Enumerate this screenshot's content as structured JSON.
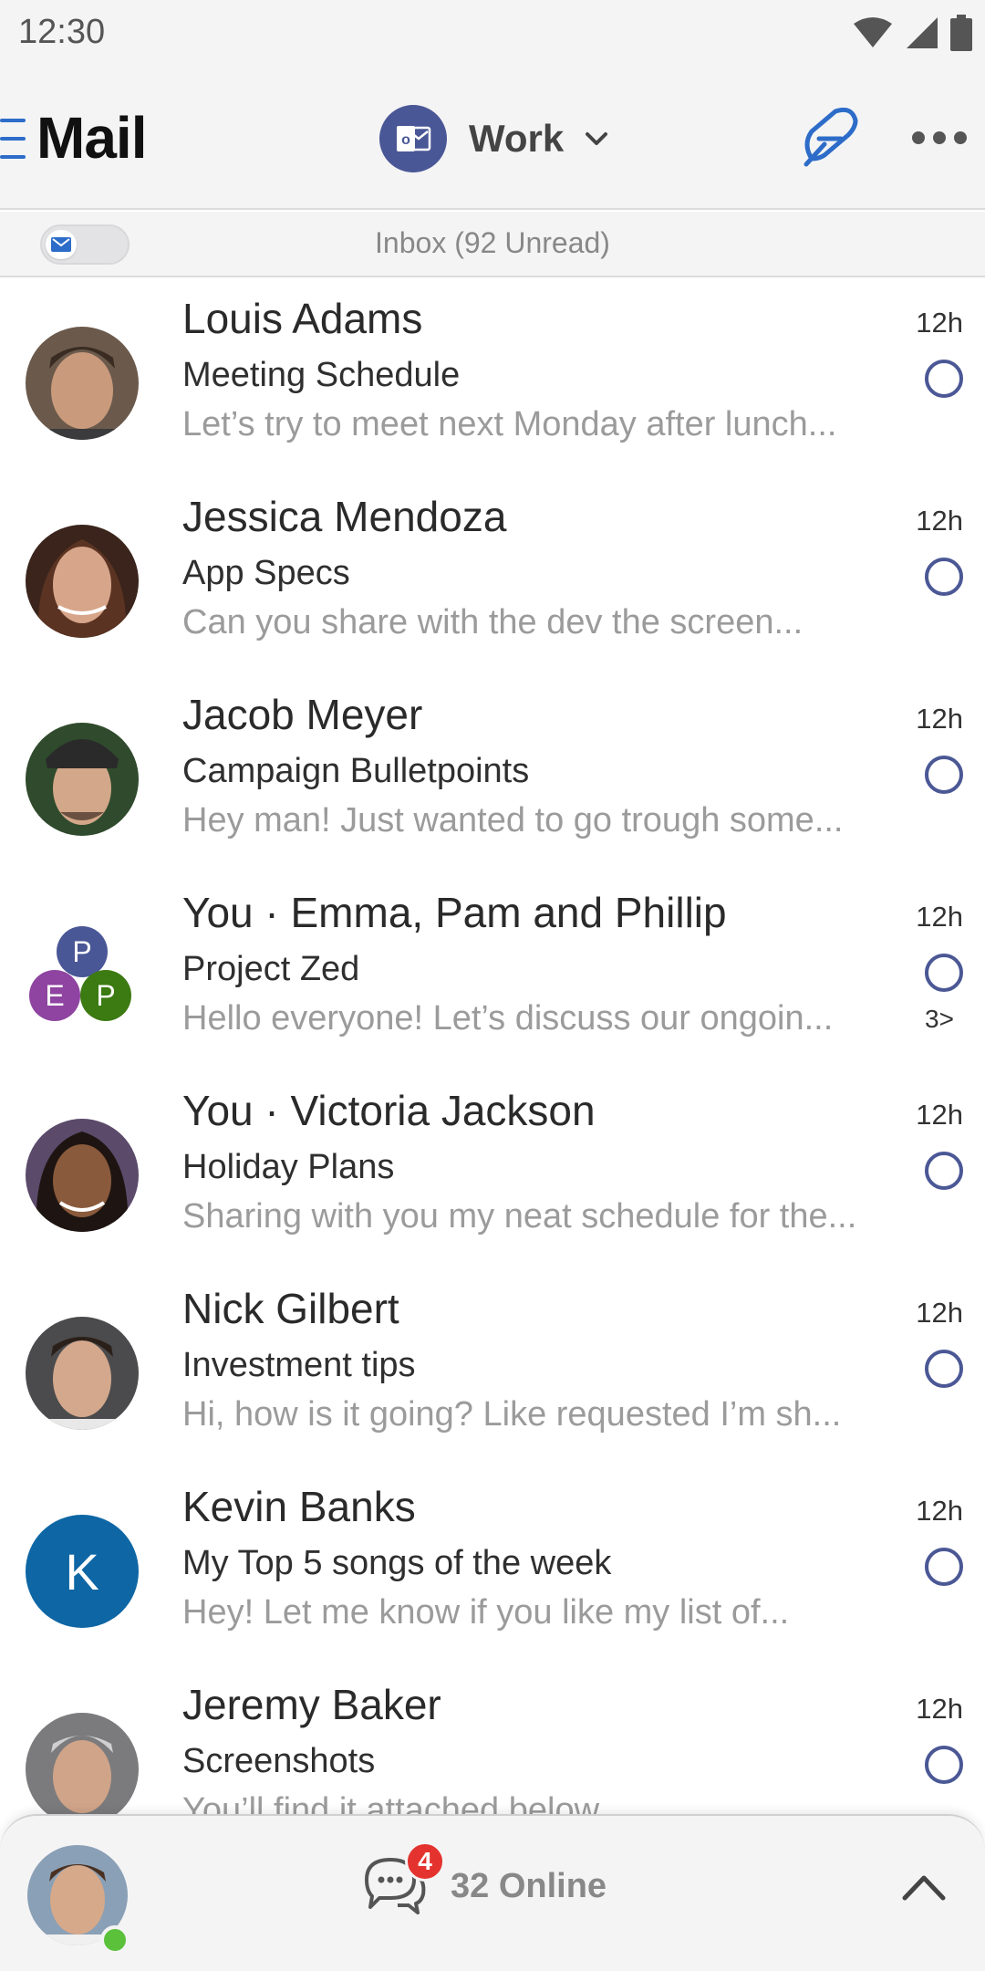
{
  "status_bar": {
    "time": "12:30",
    "icons": [
      "wifi-icon",
      "signal-icon",
      "battery-icon"
    ]
  },
  "header": {
    "title": "Mail",
    "account": "Work",
    "icons": {
      "menu": "hamburger-icon",
      "account": "outlook-icon",
      "dropdown": "chevron-down-icon",
      "compose": "compose-icon",
      "more": "more-icon"
    }
  },
  "inbox": {
    "label": "Inbox (92 Unread)",
    "toggle_icon": "mail-icon"
  },
  "colors": {
    "accent": "#2d6cc8",
    "outlook": "#4a5796",
    "unread_circle": "#4b5895",
    "badge": "#e4332e",
    "online": "#5cc13a"
  },
  "mails": [
    {
      "sender": "Louis Adams",
      "subject": "Meeting Schedule",
      "preview": "Let’s try to meet next Monday after lunch...",
      "time": "12h",
      "avatar": "photo"
    },
    {
      "sender": "Jessica Mendoza",
      "subject": "App Specs",
      "preview": "Can you share with the dev the screen...",
      "time": "12h",
      "avatar": "photo"
    },
    {
      "sender": "Jacob Meyer",
      "subject": "Campaign Bulletpoints",
      "preview": "Hey man! Just wanted to go trough some...",
      "time": "12h",
      "avatar": "photo"
    },
    {
      "sender": "You · Emma, Pam and Phillip",
      "subject": "Project Zed",
      "preview": "Hello everyone! Let’s discuss our ongoin...",
      "time": "12h",
      "thread_count": "3>",
      "avatar": "group",
      "group_initials": [
        "P",
        "E",
        "P"
      ]
    },
    {
      "sender": "You · Victoria Jackson",
      "subject": "Holiday Plans",
      "preview": "Sharing with you my neat schedule for the...",
      "time": "12h",
      "avatar": "photo"
    },
    {
      "sender": "Nick Gilbert",
      "subject": "Investment tips",
      "preview": "Hi, how is it going? Like requested I’m sh...",
      "time": "12h",
      "avatar": "photo"
    },
    {
      "sender": "Kevin Banks",
      "subject": "My Top 5 songs of the week",
      "preview": "Hey! Let me know if you like my list of...",
      "time": "12h",
      "avatar": "initial",
      "initial": "K"
    },
    {
      "sender": "Jeremy Baker",
      "subject": "Screenshots",
      "preview": "You’ll find it attached below...",
      "time": "12h",
      "avatar": "photo"
    }
  ],
  "bottom_bar": {
    "online_label": "32 Online",
    "chat_badge": "4",
    "icons": {
      "chat": "chat-icon",
      "collapse": "chevron-up-icon"
    }
  }
}
